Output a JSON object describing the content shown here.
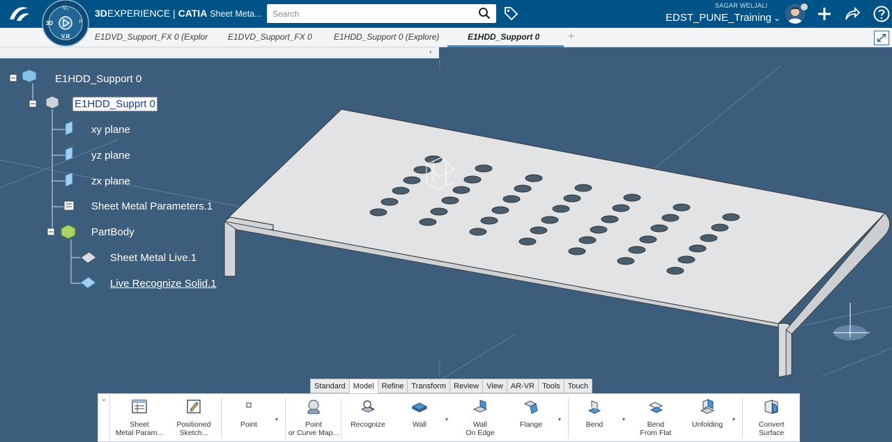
{
  "header": {
    "brand_strong": "3D",
    "brand_rest": "EXPERIENCE | ",
    "brand_product": "CATIA",
    "app_name": "Sheet Meta...",
    "search_placeholder": "Search",
    "user_name": "SAGAR WELJALI",
    "workspace": "EDST_PUNE_Training",
    "compass_labels": {
      "top": "V₂",
      "left": "3D",
      "right": "i²",
      "bottom": "V.R"
    }
  },
  "tabs": [
    {
      "label": "E1DVD_Support_FX 0 (Explor"
    },
    {
      "label": "E1DVD_Support_FX 0"
    },
    {
      "label": "E1HDD_Support 0 (Explore)"
    },
    {
      "label": "E1HDD_Support 0"
    }
  ],
  "tab_add": "+",
  "tree_collapse_glyph": "‹",
  "tree": [
    {
      "label": "E1HDD_Support 0"
    },
    {
      "label": "E1HDD_Supprt 0"
    },
    {
      "label": "xy plane"
    },
    {
      "label": "yz plane"
    },
    {
      "label": "zx plane"
    },
    {
      "label": "Sheet Metal Parameters.1"
    },
    {
      "label": "PartBody"
    },
    {
      "label": "Sheet Metal Live.1"
    },
    {
      "label": "Live Recognize Solid.1"
    }
  ],
  "command_tabs": [
    "Standard",
    "Model",
    "Refine",
    "Transform",
    "Review",
    "View",
    "AR-VR",
    "Tools",
    "Touch"
  ],
  "active_command_tab": "Model",
  "commands": [
    {
      "label": "Sheet\nMetal Param..."
    },
    {
      "label": "Positioned\nSketch..."
    },
    {
      "label": "Point"
    },
    {
      "label": "Point\nor Curve Map..."
    },
    {
      "label": "Recognize"
    },
    {
      "label": "Wall"
    },
    {
      "label": "Wall\nOn Edge"
    },
    {
      "label": "Flange"
    },
    {
      "label": "Bend"
    },
    {
      "label": "Bend\nFrom Flat"
    },
    {
      "label": "Unfolding"
    },
    {
      "label": "Convert\nSurface"
    }
  ],
  "colors": {
    "header_bg": "#005386",
    "viewport_bg": "#3c5e7c",
    "tab_accent": "#368ec4",
    "part_face": "#e1e3e4"
  }
}
